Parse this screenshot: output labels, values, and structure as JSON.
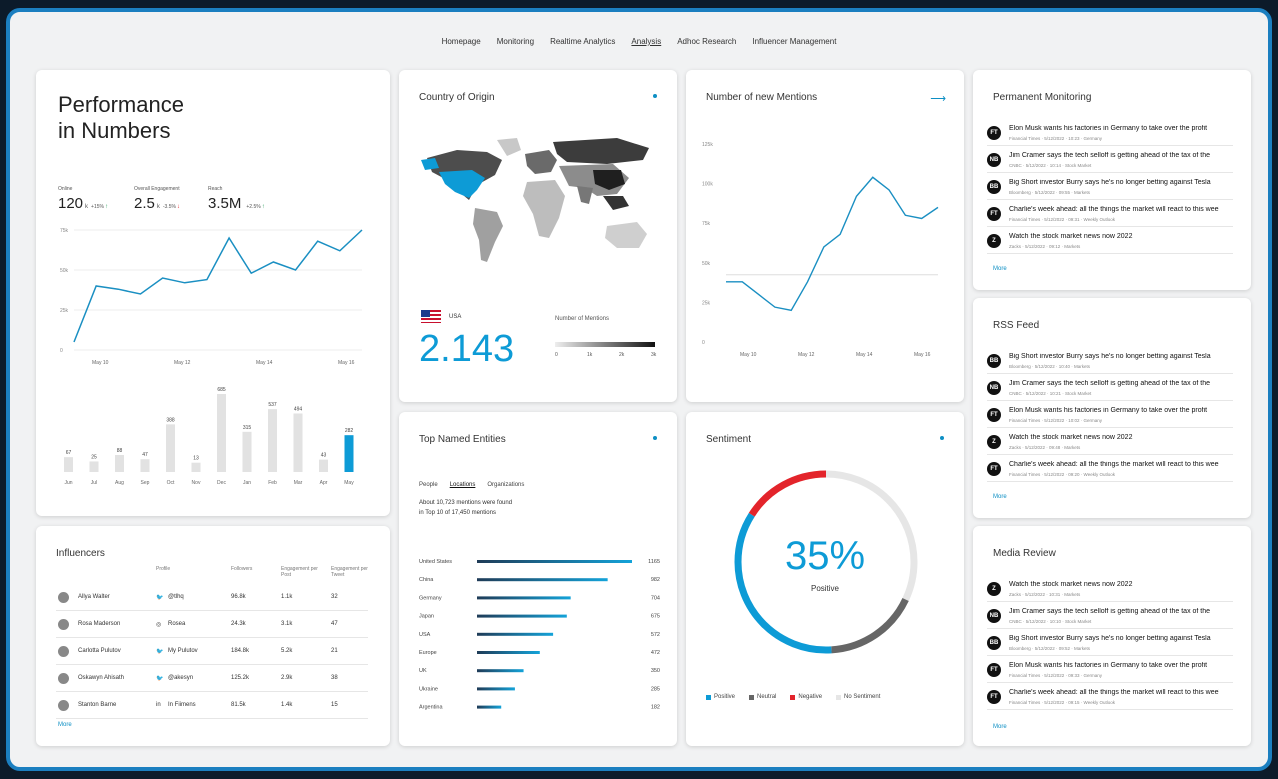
{
  "nav": [
    "Homepage",
    "Monitoring",
    "Realtime Analytics",
    "Analysis",
    "Adhoc Research",
    "Influencer Management"
  ],
  "nav_active": "Analysis",
  "performance": {
    "title_line1": "Performance",
    "title_line2": "in Numbers",
    "kpis": [
      {
        "label": "Online",
        "value": "120",
        "unit": "k",
        "delta": "+15%",
        "trend": "up"
      },
      {
        "label": "Overall Engagement",
        "value": "2.5",
        "unit": "k",
        "delta": "-3.5%",
        "trend": "down"
      },
      {
        "label": "Reach",
        "value": "3.5M",
        "unit": "",
        "delta": "+2.5%",
        "trend": "up"
      }
    ],
    "line_yticks": [
      "75k",
      "50k",
      "25k",
      "0"
    ],
    "line_xticks": [
      "May 10",
      "May 12",
      "May 14",
      "May 16"
    ],
    "bar_months": [
      "Jun",
      "Jul",
      "Aug",
      "Sep",
      "Oct",
      "Nov",
      "Dec",
      "Jan",
      "Feb",
      "Mar",
      "Apr",
      "May"
    ],
    "bar_values": [
      67,
      25,
      88,
      47,
      388,
      13,
      685,
      315,
      537,
      494,
      43,
      282
    ],
    "bar_labels": [
      "67",
      "25",
      "88",
      "47",
      "388",
      "13",
      "685",
      "315",
      "537",
      "494",
      "43",
      "282"
    ]
  },
  "country": {
    "title": "Country of Origin",
    "country_name": "USA",
    "value": "2.143",
    "legend_title": "Number of Mentions",
    "legend_ticks": [
      "0",
      "1k",
      "2k",
      "3k"
    ]
  },
  "mentions": {
    "title": "Number of new Mentions",
    "yticks": [
      "125k",
      "100k",
      "75k",
      "50k",
      "25k",
      "0"
    ],
    "xticks": [
      "May 10",
      "May 12",
      "May 14",
      "May 16"
    ]
  },
  "permanent": {
    "title": "Permanent Monitoring",
    "more": "More",
    "items": [
      {
        "icon": "FT",
        "title": "Elon Musk wants his factories in Germany to take over the profit",
        "meta": "Financial Times · 5/12/2022 · 10:23 · Germany"
      },
      {
        "icon": "NB",
        "title": "Jim Cramer says the tech selloff is getting ahead of the tax of the",
        "meta": "CNBC · 5/12/2022 · 10:14 · Stock Market"
      },
      {
        "icon": "BB",
        "title": "Big Short investor Burry says he's no longer betting against Tesla",
        "meta": "Bloomberg · 5/12/2022 · 09:55 · Markets"
      },
      {
        "icon": "FT",
        "title": "Charlie's week ahead: all the things the market will react to this week",
        "meta": "Financial Times · 5/12/2022 · 09:31 · Weekly Outlook"
      },
      {
        "icon": "Z",
        "title": "Watch the stock market news now 2022",
        "meta": "Zacks · 5/12/2022 · 09:12 · Markets"
      }
    ]
  },
  "rss": {
    "title": "RSS Feed",
    "more": "More",
    "items": [
      {
        "icon": "BB",
        "title": "Big Short investor Burry says he's no longer betting against Tesla",
        "meta": "Bloomberg · 5/12/2022 · 10:40 · Markets"
      },
      {
        "icon": "NB",
        "title": "Jim Cramer says the tech selloff is getting ahead of the tax of the",
        "meta": "CNBC · 5/12/2022 · 10:21 · Stock Market"
      },
      {
        "icon": "FT",
        "title": "Elon Musk wants his factories in Germany to take over the profit",
        "meta": "Financial Times · 5/12/2022 · 10:02 · Germany"
      },
      {
        "icon": "Z",
        "title": "Watch the stock market news now 2022",
        "meta": "Zacks · 5/12/2022 · 09:48 · Markets"
      },
      {
        "icon": "FT",
        "title": "Charlie's week ahead: all the things the market will react to this week",
        "meta": "Financial Times · 5/12/2022 · 09:20 · Weekly Outlook"
      }
    ]
  },
  "media": {
    "title": "Media Review",
    "more": "More",
    "items": [
      {
        "icon": "Z",
        "title": "Watch the stock market news now 2022",
        "meta": "Zacks · 5/12/2022 · 10:31 · Markets"
      },
      {
        "icon": "NB",
        "title": "Jim Cramer says the tech selloff is getting ahead of the tax of the",
        "meta": "CNBC · 5/12/2022 · 10:10 · Stock Market"
      },
      {
        "icon": "BB",
        "title": "Big Short investor Burry says he's no longer betting against Tesla",
        "meta": "Bloomberg · 5/12/2022 · 09:52 · Markets"
      },
      {
        "icon": "FT",
        "title": "Elon Musk wants his factories in Germany to take over the profit",
        "meta": "Financial Times · 5/12/2022 · 09:33 · Germany"
      },
      {
        "icon": "FT",
        "title": "Charlie's week ahead: all the things the market will react to this week",
        "meta": "Financial Times · 5/12/2022 · 09:15 · Weekly Outlook"
      }
    ]
  },
  "entities": {
    "title": "Top Named Entities",
    "tabs": [
      "People",
      "Locations",
      "Organizations"
    ],
    "active_tab": "Locations",
    "summary1": "About 10,723 mentions were found",
    "summary2": "in Top 10 of 17,450 mentions",
    "rows": [
      {
        "name": "United States",
        "value": 1165,
        "label": "1165"
      },
      {
        "name": "China",
        "value": 982,
        "label": "982"
      },
      {
        "name": "Germany",
        "value": 704,
        "label": "704"
      },
      {
        "name": "Japan",
        "value": 675,
        "label": "675"
      },
      {
        "name": "USA",
        "value": 572,
        "label": "572"
      },
      {
        "name": "Europe",
        "value": 472,
        "label": "472"
      },
      {
        "name": "UK",
        "value": 350,
        "label": "350"
      },
      {
        "name": "Ukraine",
        "value": 285,
        "label": "285"
      },
      {
        "name": "Argentina",
        "value": 182,
        "label": "182"
      }
    ]
  },
  "sentiment": {
    "title": "Sentiment",
    "percent": "35%",
    "label": "Positive",
    "positive": 35,
    "neutral": 17,
    "negative": 16,
    "no_sentiment": 32,
    "legend": [
      "Positive",
      "Neutral",
      "Negative",
      "No Sentiment"
    ],
    "colors": {
      "positive": "#0d9bd6",
      "neutral": "#666666",
      "negative": "#e3242b",
      "none": "#e6e6e6"
    }
  },
  "influencers": {
    "title": "Influencers",
    "columns": [
      "",
      "Profile",
      "Followers",
      "Engagement per Post",
      "Engagement per Tweet"
    ],
    "more": "More",
    "rows": [
      {
        "name": "Allya Walter",
        "handle": "@tlhq",
        "icon": "twitter-icon",
        "followers": "96.8k",
        "eng1": "1.1k",
        "eng2": "32"
      },
      {
        "name": "Rosa Maderson",
        "handle": "Rosea",
        "icon": "instagram-icon",
        "followers": "24.3k",
        "eng1": "3.1k",
        "eng2": "47"
      },
      {
        "name": "Carlotta Pulutov",
        "handle": "My Pulutov",
        "icon": "twitter-icon",
        "followers": "184.8k",
        "eng1": "5.2k",
        "eng2": "21"
      },
      {
        "name": "Oskawyn Ahisath",
        "handle": "@akesyn",
        "icon": "twitter-icon",
        "followers": "125.2k",
        "eng1": "2.9k",
        "eng2": "38"
      },
      {
        "name": "Stanton Barne",
        "handle": "In Fiimens",
        "icon": "linkedin-icon",
        "followers": "81.5k",
        "eng1": "1.4k",
        "eng2": "15"
      }
    ]
  }
}
